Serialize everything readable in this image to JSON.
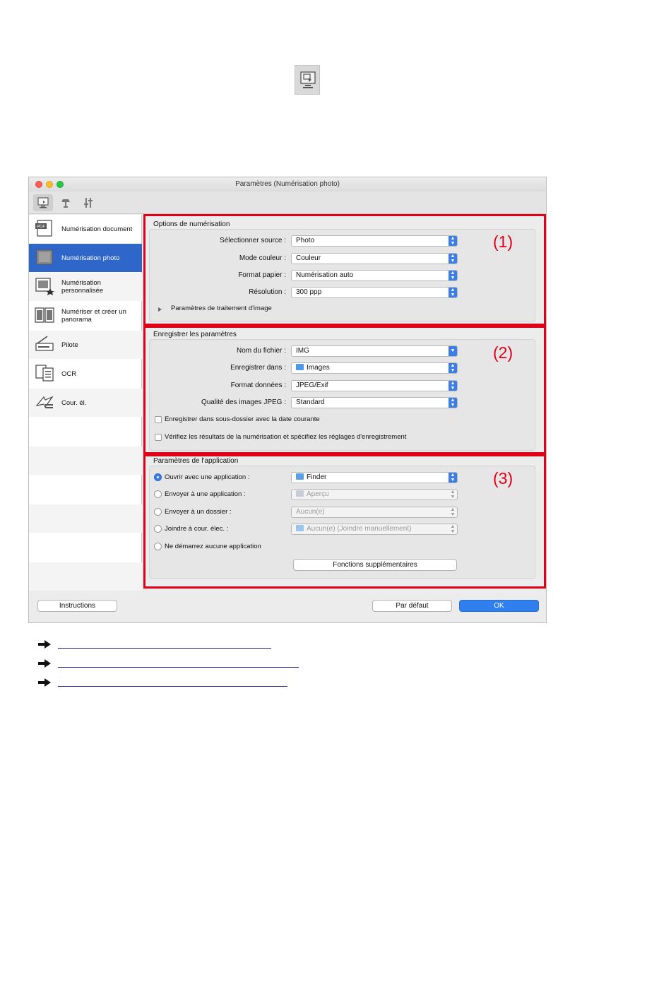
{
  "window": {
    "title": "Paramètres (Numérisation photo)"
  },
  "sidebar": {
    "items": [
      {
        "label": "Numérisation document"
      },
      {
        "label": "Numérisation photo"
      },
      {
        "label": "Numérisation personnalisée"
      },
      {
        "label": "Numériser et créer un panorama"
      },
      {
        "label": "Pilote"
      },
      {
        "label": "OCR"
      },
      {
        "label": "Cour. él."
      }
    ]
  },
  "section1": {
    "title": "Options de numérisation",
    "number": "(1)",
    "rows": [
      {
        "label": "Sélectionner source :",
        "value": "Photo"
      },
      {
        "label": "Mode couleur :",
        "value": "Couleur"
      },
      {
        "label": "Format papier :",
        "value": "Numérisation auto"
      },
      {
        "label": "Résolution :",
        "value": "300 ppp"
      }
    ],
    "disclosure": "Paramètres de traitement d'image"
  },
  "section2": {
    "title": "Enregistrer les paramètres",
    "number": "(2)",
    "rows": [
      {
        "label": "Nom du fichier :",
        "value": "IMG"
      },
      {
        "label": "Enregistrer dans :",
        "value": "Images"
      },
      {
        "label": "Format données :",
        "value": "JPEG/Exif"
      },
      {
        "label": "Qualité des images JPEG :",
        "value": "Standard"
      }
    ],
    "check1": "Enregistrer dans sous-dossier avec la date courante",
    "check2": "Vérifiez les résultats de la numérisation et spécifiez les réglages d'enregistrement"
  },
  "section3": {
    "title": "Paramètres de l'application",
    "number": "(3)",
    "options": [
      {
        "label": "Ouvrir avec une application :",
        "value": "Finder"
      },
      {
        "label": "Envoyer à une application :",
        "value": "Aperçu"
      },
      {
        "label": "Envoyer à un dossier :",
        "value": "Aucun(e)"
      },
      {
        "label": "Joindre à cour. élec. :",
        "value": "Aucun(e) (Joindre manuellement)"
      },
      {
        "label": "Ne démarrez aucune application"
      }
    ],
    "more_button": "Fonctions supplémentaires"
  },
  "footer": {
    "instructions": "Instructions",
    "default": "Par défaut",
    "ok": "OK"
  },
  "colors": {
    "highlight_red": "#e0001a",
    "selection_blue": "#2f66c9",
    "accent_blue": "#3a7ee6"
  }
}
